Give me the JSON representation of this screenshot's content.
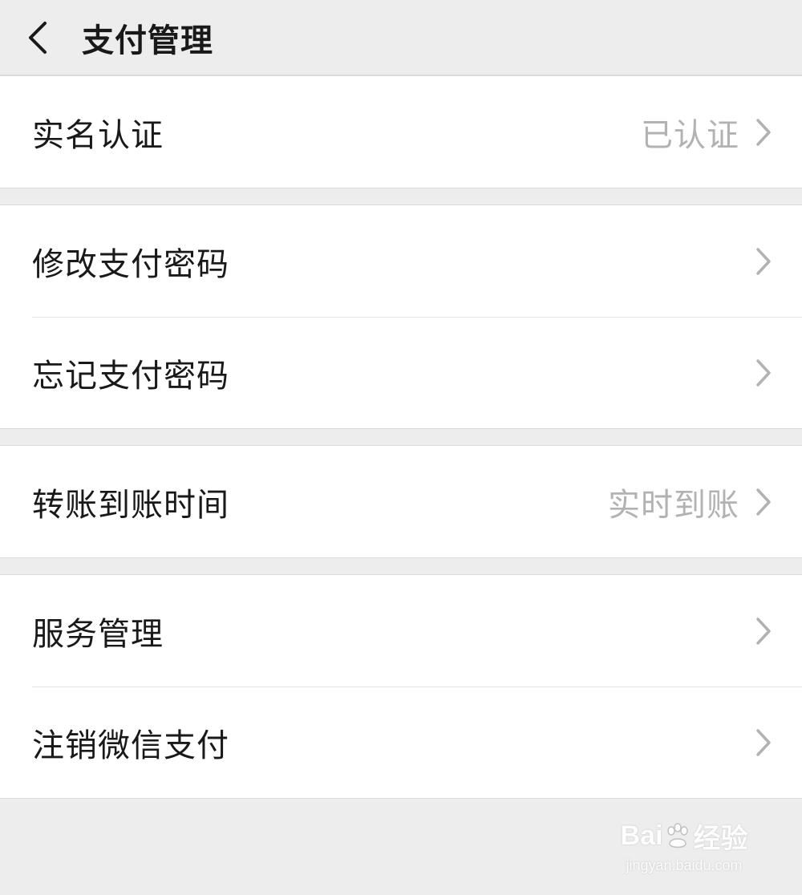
{
  "header": {
    "back_icon": "chevron-left-icon",
    "title": "支付管理"
  },
  "groups": [
    {
      "rows": [
        {
          "label": "实名认证",
          "value": "已认证"
        }
      ]
    },
    {
      "rows": [
        {
          "label": "修改支付密码",
          "value": ""
        },
        {
          "label": "忘记支付密码",
          "value": ""
        }
      ]
    },
    {
      "rows": [
        {
          "label": "转账到账时间",
          "value": "实时到账"
        }
      ]
    },
    {
      "rows": [
        {
          "label": "服务管理",
          "value": ""
        },
        {
          "label": "注销微信支付",
          "value": ""
        }
      ]
    }
  ],
  "watermark": {
    "logo_left": "Bai",
    "logo_right": "经验",
    "url": "jingyan.baidu.com"
  },
  "colors": {
    "background": "#ededed",
    "card": "#ffffff",
    "text": "#191919",
    "secondary_text": "#b2b2b2",
    "chevron": "#b2b2b2"
  }
}
